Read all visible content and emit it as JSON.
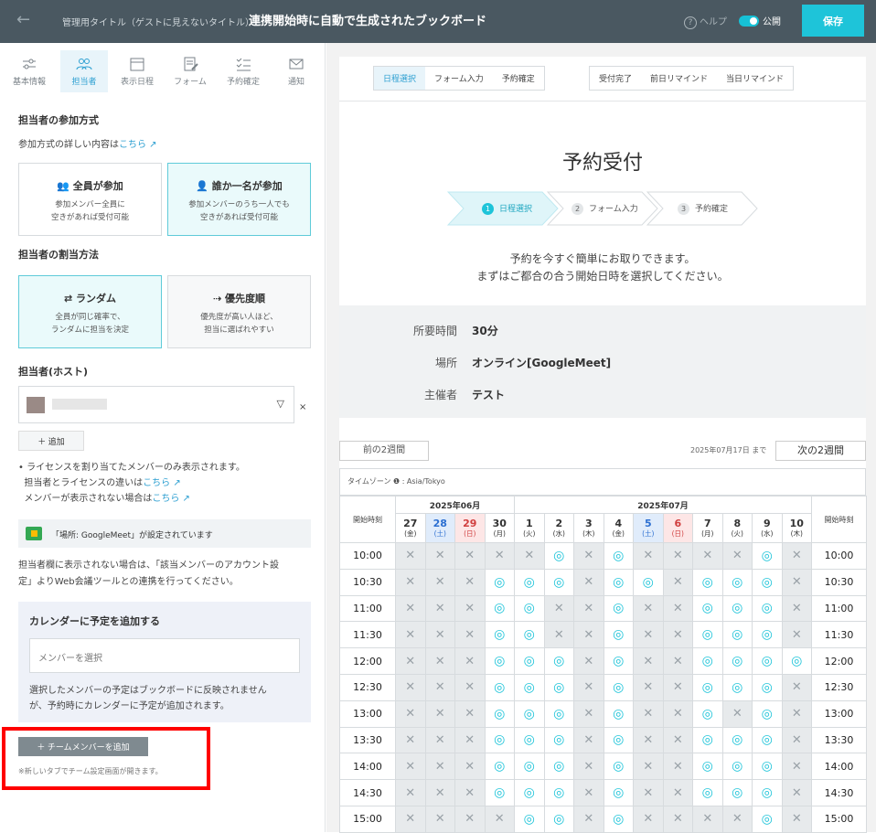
{
  "header": {
    "back_icon": "arrow-left-icon",
    "admin_label": "管理用タイトル（ゲストに見えないタイトル）",
    "board_title": "連携開始時に自動で生成されたブックボード",
    "help": "ヘルプ",
    "public": "公開",
    "save": "保存"
  },
  "tabs": [
    {
      "label": "基本情報",
      "icon": "sliders-icon"
    },
    {
      "label": "担当者",
      "icon": "people-icon"
    },
    {
      "label": "表示日程",
      "icon": "calendar-icon"
    },
    {
      "label": "フォーム",
      "icon": "form-edit-icon"
    },
    {
      "label": "予約確定",
      "icon": "checklist-icon"
    },
    {
      "label": "通知",
      "icon": "mail-icon"
    }
  ],
  "participation": {
    "title": "担当者の参加方式",
    "detail": "参加方式の詳しい内容は",
    "link": "こちら",
    "options": [
      {
        "title": "全員が参加",
        "line1": "参加メンバー全員に",
        "line2": "空きがあれば受付可能"
      },
      {
        "title": "誰か一名が参加",
        "line1": "参加メンバーのうち一人でも",
        "line2": "空きがあれば受付可能"
      }
    ]
  },
  "assignment": {
    "title": "担当者の割当方法",
    "options": [
      {
        "title": "ランダム",
        "line1": "全員が同じ確率で、",
        "line2": "ランダムに担当を決定"
      },
      {
        "title": "優先度順",
        "line1": "優先度が高い人ほど、",
        "line2": "担当に選ばれやすい"
      }
    ]
  },
  "host": {
    "title": "担当者(ホスト)",
    "remove": "×",
    "add": "追加",
    "note1": "ライセンスを割り当てたメンバーのみ表示されます。",
    "note2": "担当者とライセンスの違いは",
    "note3": "メンバーが表示されない場合は",
    "link": "こちら"
  },
  "meet": {
    "text": "「場所: GoogleMeet」が設定されています",
    "help1": "担当者欄に表示されない場合は、「該当メンバーのアカウント設",
    "help2": "定」よりWeb会議ツールとの連携を行ってください。"
  },
  "calendar_add": {
    "title": "カレンダーに予定を追加する",
    "placeholder": "メンバーを選択",
    "note1": "選択したメンバーの予定はブックボードに反映されません",
    "note2": "が、予約時にカレンダーに予定が追加されます。"
  },
  "team": {
    "button": "チームメンバーを追加",
    "note": "※新しいタブでチーム設定画面が開きます。"
  },
  "preview": {
    "step_tabs1": [
      "日程選択",
      "フォーム入力",
      "予約確定"
    ],
    "step_tabs2": [
      "受付完了",
      "前日リマインド",
      "当日リマインド"
    ],
    "title": "予約受付",
    "steps": [
      {
        "num": "1",
        "label": "日程選択"
      },
      {
        "num": "2",
        "label": "フォーム入力"
      },
      {
        "num": "3",
        "label": "予約確定"
      }
    ],
    "text1": "予約を今すぐ簡単にお取りできます。",
    "text2": "まずはご都合の合う開始日時を選択してください。",
    "info": [
      {
        "key": "所要時間",
        "value": "30分"
      },
      {
        "key": "場所",
        "value": "オンライン[GoogleMeet]"
      },
      {
        "key": "主催者",
        "value": "テスト"
      }
    ],
    "prev": "前の2週間",
    "next": "次の2週間",
    "until": "2025年07月17日 まで",
    "timezone": "タイムゾーン ❶ : Asia/Tokyo",
    "month1": "2025年06月",
    "month2": "2025年07月",
    "start_label": "開始時刻",
    "days": [
      {
        "d": "27",
        "w": "(金)",
        "t": ""
      },
      {
        "d": "28",
        "w": "(土)",
        "t": "sat"
      },
      {
        "d": "29",
        "w": "(日)",
        "t": "sun"
      },
      {
        "d": "30",
        "w": "(月)",
        "t": ""
      },
      {
        "d": "1",
        "w": "(火)",
        "t": ""
      },
      {
        "d": "2",
        "w": "(水)",
        "t": ""
      },
      {
        "d": "3",
        "w": "(木)",
        "t": ""
      },
      {
        "d": "4",
        "w": "(金)",
        "t": ""
      },
      {
        "d": "5",
        "w": "(土)",
        "t": "sat"
      },
      {
        "d": "6",
        "w": "(日)",
        "t": "sun"
      },
      {
        "d": "7",
        "w": "(月)",
        "t": ""
      },
      {
        "d": "8",
        "w": "(火)",
        "t": ""
      },
      {
        "d": "9",
        "w": "(水)",
        "t": ""
      },
      {
        "d": "10",
        "w": "(木)",
        "t": ""
      }
    ],
    "rows": [
      {
        "time": "10:00",
        "slots": "xxxxxoxoxxxxox"
      },
      {
        "time": "10:30",
        "slots": "xxxoooxooxooox"
      },
      {
        "time": "11:00",
        "slots": "xxxooxxoxxooox"
      },
      {
        "time": "11:30",
        "slots": "xxxooxxoxxooox"
      },
      {
        "time": "12:00",
        "slots": "xxxoooxoxxoooo"
      },
      {
        "time": "12:30",
        "slots": "xxxoooxoxxooox"
      },
      {
        "time": "13:00",
        "slots": "xxxoooxoxxoxox"
      },
      {
        "time": "13:30",
        "slots": "xxxoooxoxxooox"
      },
      {
        "time": "14:00",
        "slots": "xxxoooxoxxooox"
      },
      {
        "time": "14:30",
        "slots": "xxxoooxoxxooox"
      },
      {
        "time": "15:00",
        "slots": "xxxxooxoxxxxox"
      }
    ],
    "symbol_x": "✕",
    "symbol_o": "◎"
  },
  "colors": {
    "accent": "#1ec4d9",
    "header": "#4a5861",
    "highlight": "#ff0000"
  }
}
